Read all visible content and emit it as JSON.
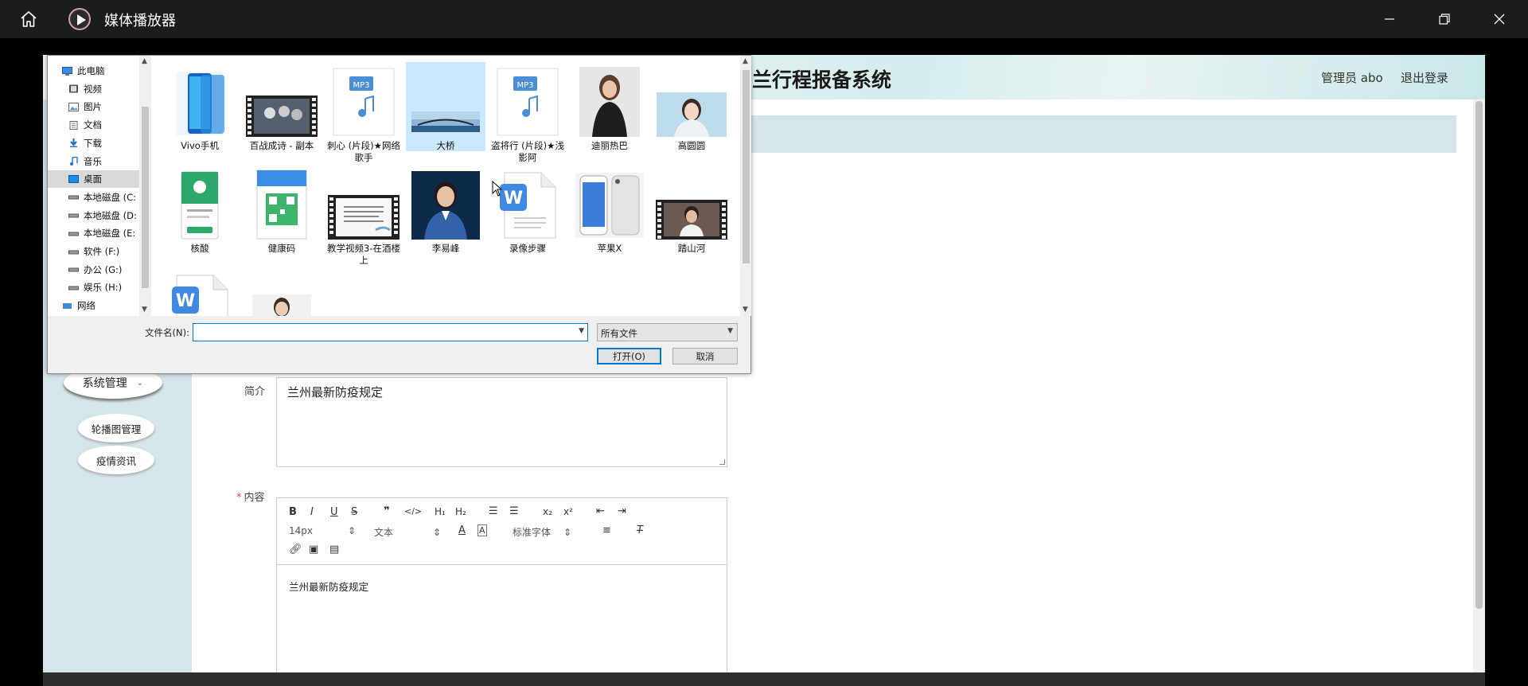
{
  "app": {
    "title": "媒体播放器"
  },
  "web": {
    "title": "兰行程报备系统",
    "user": "管理员 abo",
    "logout": "退出登录",
    "menu": {
      "system": "系统管理",
      "sub1": "轮播图管理",
      "sub2": "疫情资讯"
    },
    "form": {
      "intro_label": "简介",
      "intro_value": "兰州最新防疫规定",
      "content_label": "内容",
      "content_value": "兰州最新防疫规定",
      "font_size": "14px",
      "block_type": "文本",
      "font_family": "标准字体"
    }
  },
  "dialog": {
    "nav": [
      {
        "label": "此电脑",
        "icon": "computer-icon"
      },
      {
        "label": "视频",
        "icon": "video-folder-icon"
      },
      {
        "label": "图片",
        "icon": "pictures-folder-icon"
      },
      {
        "label": "文档",
        "icon": "documents-folder-icon"
      },
      {
        "label": "下载",
        "icon": "download-icon"
      },
      {
        "label": "音乐",
        "icon": "music-icon"
      },
      {
        "label": "桌面",
        "icon": "desktop-icon",
        "selected": true
      },
      {
        "label": "本地磁盘 (C:",
        "icon": "drive-icon"
      },
      {
        "label": "本地磁盘 (D:",
        "icon": "drive-icon"
      },
      {
        "label": "本地磁盘 (E:",
        "icon": "drive-icon"
      },
      {
        "label": "软件 (F:)",
        "icon": "drive-icon"
      },
      {
        "label": "办公 (G:)",
        "icon": "drive-icon"
      },
      {
        "label": "娱乐 (H:)",
        "icon": "drive-icon"
      },
      {
        "label": "网络",
        "icon": "network-icon"
      }
    ],
    "files": [
      {
        "label": "Vivo手机",
        "type": "phone-image"
      },
      {
        "label": "百战成诗 - 副本",
        "type": "video"
      },
      {
        "label": "刺心 (片段)★网络歌手",
        "type": "mp3"
      },
      {
        "label": "大桥",
        "type": "bridge-image",
        "selected": true
      },
      {
        "label": "盗将行 (片段)★浅影阿",
        "type": "mp3"
      },
      {
        "label": "迪丽热巴",
        "type": "portrait-image"
      },
      {
        "label": "高圆圆",
        "type": "portrait-light-image"
      },
      {
        "label": "核酸",
        "type": "phone-green-image"
      },
      {
        "label": "健康码",
        "type": "qr-image"
      },
      {
        "label": "教学视频3-在酒楼上",
        "type": "video-doc"
      },
      {
        "label": "李易峰",
        "type": "portrait-blue-image"
      },
      {
        "label": "录像步骤",
        "type": "word-doc"
      },
      {
        "label": "苹果X",
        "type": "iphone-image"
      },
      {
        "label": "踏山河",
        "type": "video-portrait"
      },
      {
        "label": "",
        "type": "word-doc"
      },
      {
        "label": "",
        "type": "portrait-white-image"
      }
    ],
    "filename_label": "文件名(N):",
    "filename_value": "",
    "filetype": "所有文件",
    "open_label": "打开(O)",
    "cancel_label": "取消"
  }
}
